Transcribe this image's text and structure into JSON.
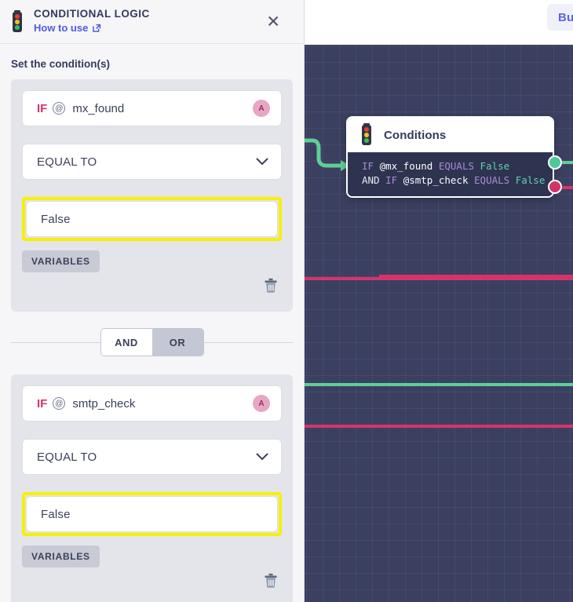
{
  "panel": {
    "icon": "traffic-light-icon",
    "title": "CONDITIONAL LOGIC",
    "how_to_use_label": "How to use",
    "how_to_use_icon": "external-link-icon",
    "close_icon": "close-icon",
    "section_title": "Set the condition(s)",
    "conditions": [
      {
        "if_keyword": "IF",
        "at_symbol": "@",
        "variable": "mx_found",
        "avatar_initial": "A",
        "operator": "EQUAL TO",
        "value": "False",
        "variables_chip": "VARIABLES",
        "delete_icon": "trash-icon",
        "highlighted": true
      },
      {
        "if_keyword": "IF",
        "at_symbol": "@",
        "variable": "smtp_check",
        "avatar_initial": "A",
        "operator": "EQUAL TO",
        "value": "False",
        "variables_chip": "VARIABLES",
        "delete_icon": "trash-icon",
        "highlighted": true
      }
    ],
    "logic_toggle": {
      "and_label": "AND",
      "or_label": "OR",
      "selected": "AND"
    }
  },
  "canvas": {
    "build_button_label": "Buil",
    "node": {
      "icon": "traffic-light-icon",
      "title": "Conditions",
      "code_lines": [
        {
          "keyword": "IF",
          "variable": "@mx_found",
          "operator": "EQUALS",
          "value": "False"
        },
        {
          "conjunction": "AND",
          "keyword": "IF",
          "variable": "@smtp_check",
          "operator": "EQUALS",
          "value": "False"
        }
      ],
      "ports": [
        {
          "name": "true-port",
          "color": "#4ec99a"
        },
        {
          "name": "false-port",
          "color": "#cf3566"
        }
      ]
    }
  },
  "colors": {
    "accent_pink": "#d6336c",
    "accent_green": "#5fcf95",
    "highlight_yellow": "#f7f000",
    "link_blue": "#4f5ae0",
    "canvas_bg": "#3b4060",
    "node_bg": "#2e3350",
    "code_keyword": "#a98bd6",
    "code_value": "#5fd3a8"
  }
}
